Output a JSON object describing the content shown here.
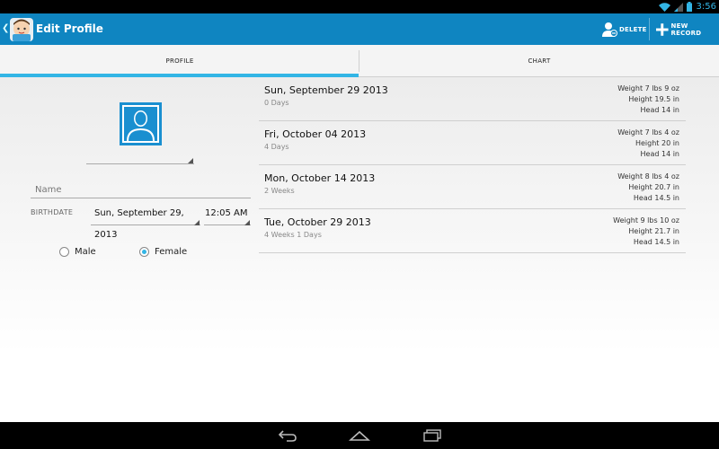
{
  "status": {
    "time": "3:56"
  },
  "action_bar": {
    "title": "Edit Profile",
    "delete_label": "DELETE",
    "new_record_label": "NEW RECORD"
  },
  "tabs": [
    {
      "label": "PROFILE",
      "selected": true
    },
    {
      "label": "CHART",
      "selected": false
    }
  ],
  "profile": {
    "name_placeholder": "Name",
    "name_value": "",
    "birthdate_label": "BIRTHDATE",
    "birthdate_date": "Sun, September 29, 2013",
    "birthdate_time": "12:05 AM",
    "gender_options": [
      {
        "label": "Male",
        "checked": false
      },
      {
        "label": "Female",
        "checked": true
      }
    ]
  },
  "records": [
    {
      "date": "Sun, September 29 2013",
      "age": "0 Days",
      "weight": "Weight 7 lbs 9 oz",
      "height": "Height 19.5 in",
      "head": "Head 14 in"
    },
    {
      "date": "Fri, October 04 2013",
      "age": "4 Days",
      "weight": "Weight 7 lbs 4 oz",
      "height": "Height 20 in",
      "head": "Head 14 in"
    },
    {
      "date": "Mon, October 14 2013",
      "age": "2 Weeks",
      "weight": "Weight 8 lbs 4 oz",
      "height": "Height 20.7 in",
      "head": "Head 14.5 in"
    },
    {
      "date": "Tue, October 29 2013",
      "age": "4 Weeks 1 Days",
      "weight": "Weight 9 lbs 10 oz",
      "height": "Height 21.7 in",
      "head": "Head 14.5 in"
    }
  ],
  "colors": {
    "action_bar": "#0f85c1",
    "accent": "#33b5e5",
    "photo": "#1a8fd0"
  },
  "icons": {
    "status": [
      "wifi-icon",
      "signal-icon",
      "battery-icon"
    ],
    "nav": [
      "back-icon",
      "home-icon",
      "recent-apps-icon"
    ]
  }
}
